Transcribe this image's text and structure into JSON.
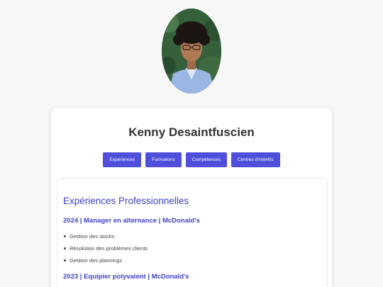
{
  "profile": {
    "name": "Kenny Desaintfuscien"
  },
  "nav": {
    "items": [
      "Expériences",
      "Formations",
      "Compétences",
      "Centres d'intérêts"
    ]
  },
  "experience": {
    "title": "Expériences Professionnelles",
    "jobs": [
      {
        "title": "2024 | Manager en alternance | McDonald's",
        "tasks": [
          "Gestion des stocks",
          "Résolution des problèmes clients",
          "Gestion des plannings"
        ]
      },
      {
        "title": "2023 | Equipier polyvalent | McDonald's",
        "tasks": []
      }
    ]
  },
  "colors": {
    "accent": "#4040c8",
    "button": "#4f4fdc"
  }
}
